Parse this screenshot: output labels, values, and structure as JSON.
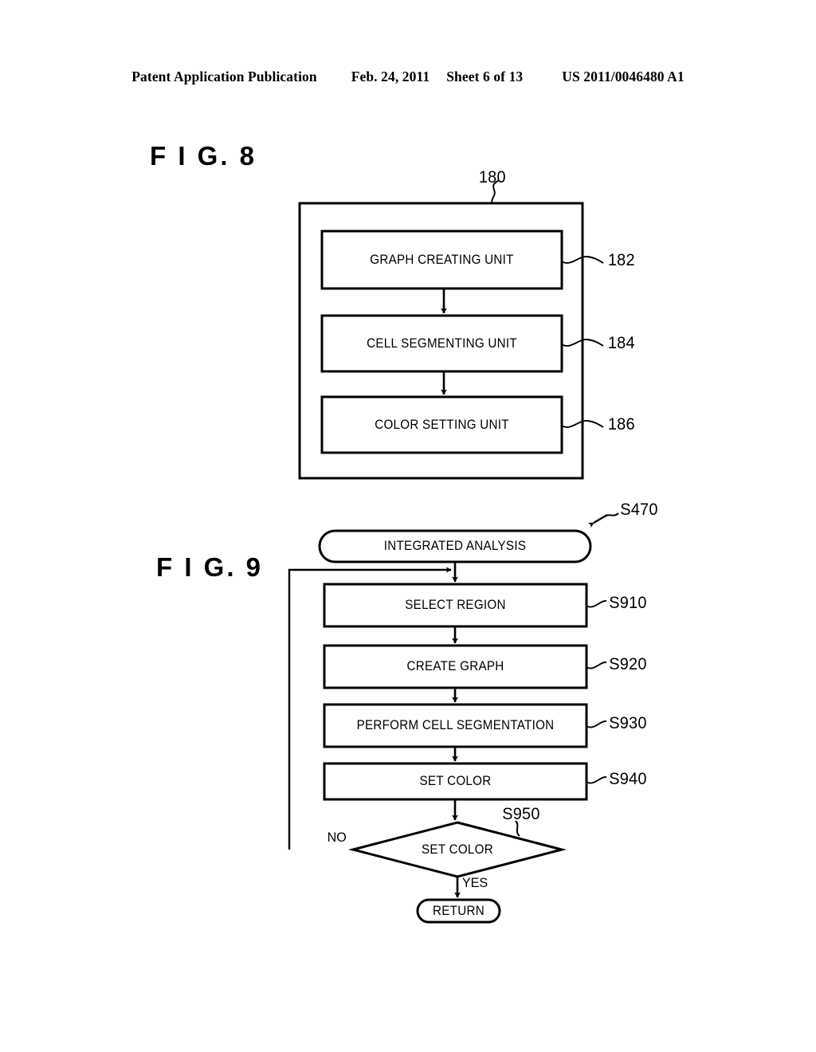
{
  "page_header": {
    "publication": "Patent Application Publication",
    "date": "Feb. 24, 2011",
    "sheet": "Sheet 6 of 13",
    "patent_number": "US 2011/0046480 A1"
  },
  "figures": [
    {
      "label": "F I G.  8",
      "type": "block-diagram",
      "container_ref": "180",
      "blocks": [
        {
          "text": "GRAPH CREATING UNIT",
          "ref": "182"
        },
        {
          "text": "CELL SEGMENTING UNIT",
          "ref": "184"
        },
        {
          "text": "COLOR SETTING UNIT",
          "ref": "186"
        }
      ]
    },
    {
      "label": "F I G.  9",
      "type": "flowchart",
      "entry_ref": "S470",
      "start": {
        "text": "INTEGRATED ANALYSIS"
      },
      "steps": [
        {
          "text": "SELECT REGION",
          "ref": "S910"
        },
        {
          "text": "CREATE GRAPH",
          "ref": "S920"
        },
        {
          "text": "PERFORM CELL SEGMENTATION",
          "ref": "S930"
        },
        {
          "text": "SET COLOR",
          "ref": "S940"
        }
      ],
      "decision": {
        "text": "SET COLOR",
        "ref": "S950",
        "no_label": "NO",
        "yes_label": "YES"
      },
      "end": {
        "text": "RETURN"
      }
    }
  ]
}
